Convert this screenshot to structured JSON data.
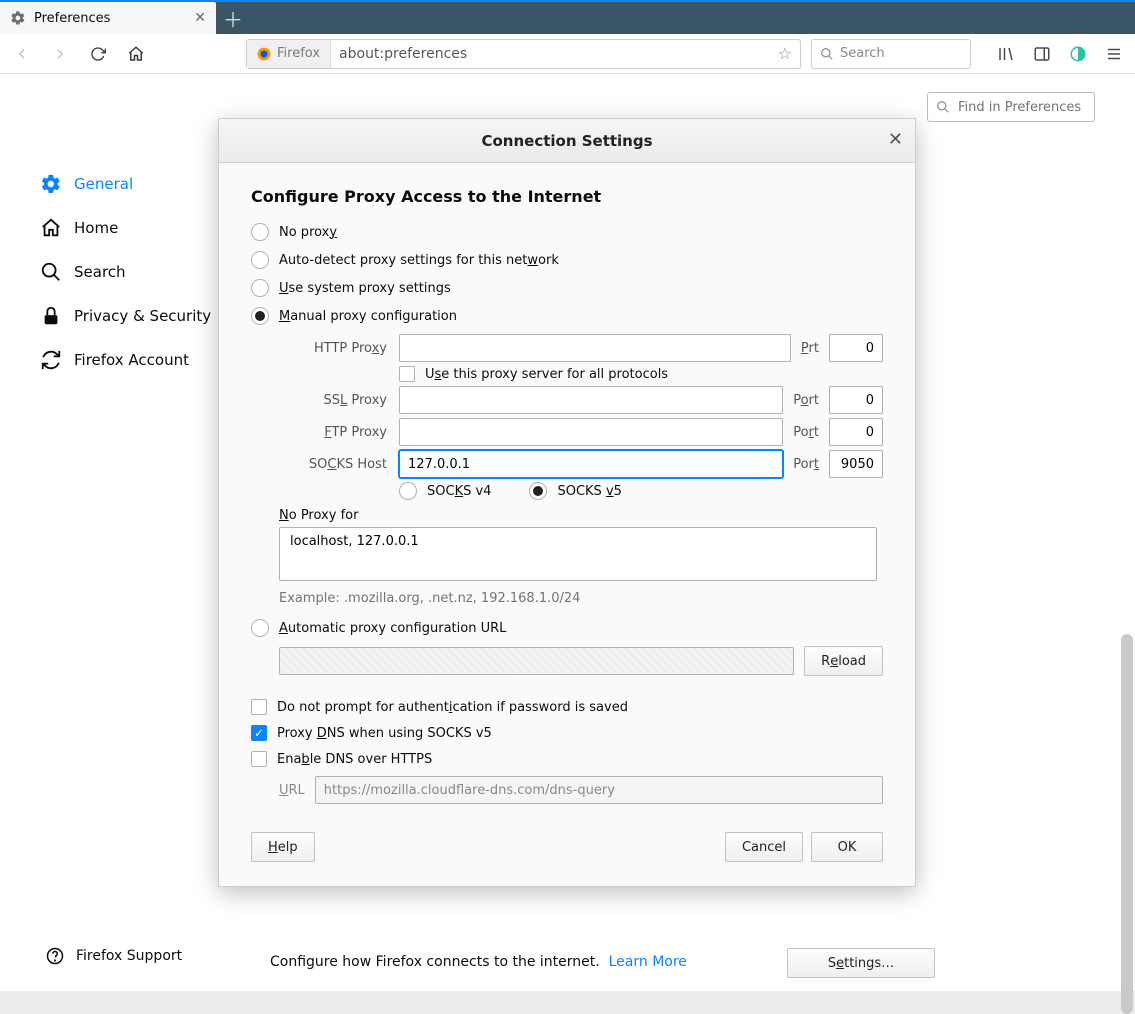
{
  "tab": {
    "title": "Preferences"
  },
  "url": {
    "scheme": "Firefox",
    "address": "about:preferences"
  },
  "search": {
    "placeholder": "Search"
  },
  "find": {
    "placeholder": "Find in Preferences"
  },
  "sidebar": {
    "items": [
      {
        "label": "General"
      },
      {
        "label": "Home"
      },
      {
        "label": "Search"
      },
      {
        "label": "Privacy & Security"
      },
      {
        "label": "Firefox Account"
      }
    ],
    "support": "Firefox Support"
  },
  "dialog": {
    "title": "Connection Settings",
    "section": "Configure Proxy Access to the Internet",
    "radios": {
      "none_pre": "No prox",
      "none_u": "y",
      "auto_pre": "Auto-detect proxy settings for this net",
      "auto_u": "w",
      "auto_post": "ork",
      "system_u": "U",
      "system_post": "se system proxy settings",
      "manual_u": "M",
      "manual_post": "anual proxy configuration",
      "autourl_u": "A",
      "autourl_post": "utomatic proxy configuration URL"
    },
    "proxy": {
      "http_label_pre": "HTTP Pro",
      "http_label_u": "x",
      "http_label_post": "y",
      "http_value": "",
      "http_port": "0",
      "useall_pre": "U",
      "useall_u": "s",
      "useall_post": "e this proxy server for all protocols",
      "ssl_label_pre": "SS",
      "ssl_label_u": "L",
      "ssl_label_post": " Proxy",
      "ssl_value": "",
      "ssl_port": "0",
      "ftp_label_u": "F",
      "ftp_label_post": "TP Proxy",
      "ftp_value": "",
      "ftp_port": "0",
      "socks_label_pre": "SO",
      "socks_label_u": "C",
      "socks_label_post": "KS Host",
      "socks_value": "127.0.0.1",
      "socks_port": "9050",
      "socks4_pre": "SOC",
      "socks4_u": "K",
      "socks4_post": "S v4",
      "socks5_pre": "SOCKS ",
      "socks5_u": "v",
      "socks5_post": "5",
      "port_pre": "P",
      "port_u_o": "o",
      "port_post_rt": "rt",
      "port_u_r": "r",
      "port_post_t": "t",
      "port_u_t": "t",
      "port_plain": "Port"
    },
    "noproxy": {
      "label_u": "N",
      "label_post": "o Proxy for",
      "value": "localhost, 127.0.0.1",
      "example": "Example: .mozilla.org, .net.nz, 192.168.1.0/24"
    },
    "reload": {
      "pre": "R",
      "u": "e",
      "post": "load"
    },
    "chk_auth_pre": "Do not prompt for authent",
    "chk_auth_u": "i",
    "chk_auth_post": "cation if password is saved",
    "chk_dns_pre": "Proxy ",
    "chk_dns_u": "D",
    "chk_dns_post": "NS when using SOCKS v5",
    "chk_doh_pre": "Ena",
    "chk_doh_u": "b",
    "chk_doh_post": "le DNS over HTTPS",
    "doh": {
      "label_u": "U",
      "label_post": "RL",
      "value": "https://mozilla.cloudflare-dns.com/dns-query"
    },
    "buttons": {
      "help_u": "H",
      "help_post": "elp",
      "cancel": "Cancel",
      "ok": "OK"
    }
  },
  "below": {
    "text": "Configure how Firefox connects to the internet.",
    "link": "Learn More",
    "settings_pre": "S",
    "settings_u": "e",
    "settings_post": "ttings…"
  }
}
